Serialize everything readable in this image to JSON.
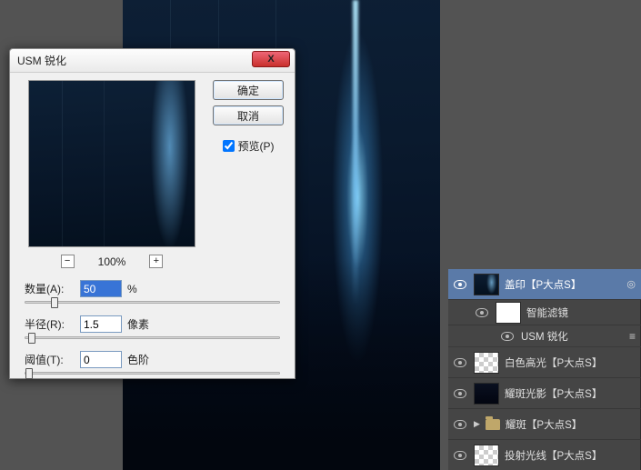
{
  "dialog": {
    "title": "USM 锐化",
    "close": "X",
    "ok": "确定",
    "cancel": "取消",
    "preview_label": "预览(P)",
    "preview_checked": true,
    "zoom": "100%",
    "minus": "−",
    "plus": "+",
    "amount": {
      "label": "数量(A):",
      "value": "50",
      "unit": "%",
      "position_pct": 10
    },
    "radius": {
      "label": "半径(R):",
      "value": "1.5",
      "unit": "像素",
      "position_pct": 1
    },
    "threshold": {
      "label": "阈值(T):",
      "value": "0",
      "unit": "色阶",
      "position_pct": 0
    }
  },
  "layers": {
    "items": [
      {
        "name": "盖印【P大点S】",
        "selected": true,
        "thumb": "dark",
        "fx": true
      },
      {
        "name": "智能滤镜",
        "sub": true,
        "thumb": "white"
      },
      {
        "name": "USM 锐化",
        "subsub": true,
        "sliders": true
      },
      {
        "name": "白色高光【P大点S】",
        "thumb": "checker"
      },
      {
        "name": "耀斑光影【P大点S】",
        "thumb": "dark2"
      },
      {
        "name": "耀斑【P大点S】",
        "folder": true
      },
      {
        "name": "投射光线【P大点S】",
        "thumb": "checker"
      }
    ]
  }
}
